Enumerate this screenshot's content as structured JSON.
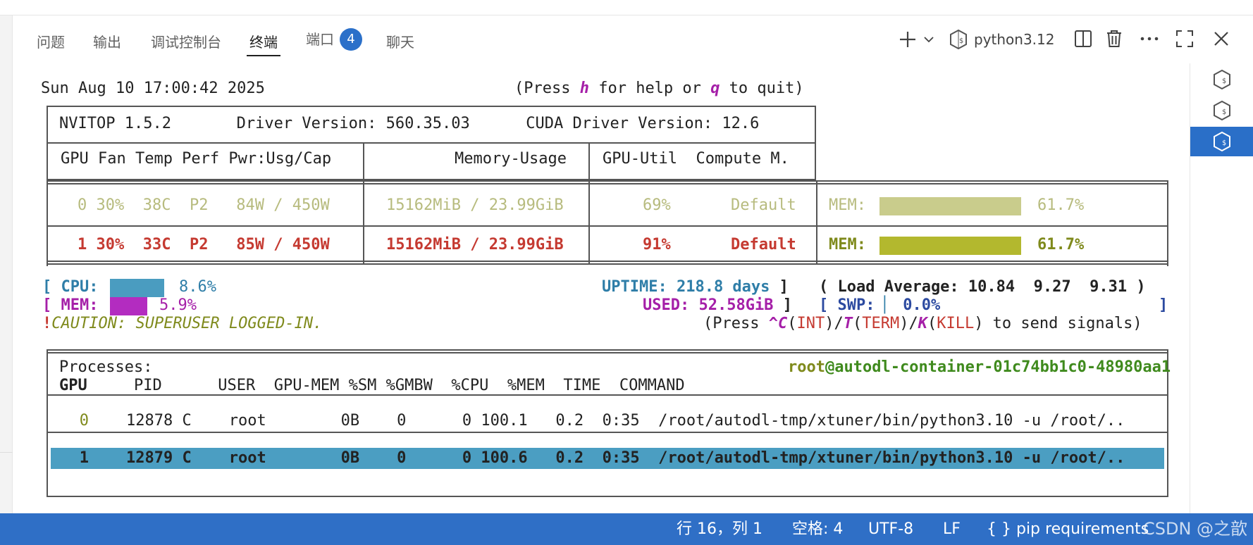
{
  "panel": {
    "tabs": [
      {
        "label": "问题"
      },
      {
        "label": "输出"
      },
      {
        "label": "调试控制台"
      },
      {
        "label": "终端"
      },
      {
        "label": "端口",
        "badge": "4"
      },
      {
        "label": "聊天"
      }
    ],
    "active_tab": "终端",
    "profile_label": "python3.12",
    "icons": [
      "plus-icon",
      "chevron-down-icon",
      "python-shell-icon",
      "split-icon",
      "trash-icon",
      "ellipsis-icon",
      "maximize-icon",
      "close-icon"
    ]
  },
  "terminal": {
    "datetime": "Sun Aug 10 17:00:42 2025",
    "help": {
      "pre": "(Press ",
      "k1": "h",
      "mid": " for help or ",
      "k2": "q",
      "post": " to quit)"
    },
    "header_line1": "NVITOP 1.5.2       Driver Version: 560.35.03      CUDA Driver Version: 12.6",
    "header_line2": {
      "left": "GPU Fan Temp Perf Pwr:Usg/Cap",
      "mid": "Memory-Usage",
      "right": "GPU-Util  Compute M."
    },
    "gpus": [
      {
        "id": "0",
        "fan": "30%",
        "temp": "38C",
        "perf": "P2",
        "pwr": "84W / 450W",
        "mem": "15162MiB / 23.99GiB",
        "util": "69%",
        "compute": "Default",
        "mem_label": "MEM:",
        "mem_pct": "61.7%",
        "mem_frac": 0.617
      },
      {
        "id": "1",
        "fan": "30%",
        "temp": "33C",
        "perf": "P2",
        "pwr": "85W / 450W",
        "mem": "15162MiB / 23.99GiB",
        "util": "91%",
        "compute": "Default",
        "mem_label": "MEM:",
        "mem_pct": "61.7%",
        "mem_frac": 0.617
      }
    ],
    "host": {
      "cpu_label": "CPU:",
      "cpu_pct": "8.6%",
      "cpu_frac": 0.086,
      "mem_label": "MEM:",
      "mem_pct": "5.9%",
      "mem_frac": 0.059,
      "uptime": "UPTIME: 218.8 days",
      "load": "( Load Average: 10.84  9.27  9.31 )",
      "used": "USED: 52.58GiB",
      "swp_label": "SWP:",
      "swp_pct": "0.0%",
      "caution": "CAUTION: SUPERUSER LOGGED-IN.",
      "signals": {
        "pre": "(Press ",
        "c": "^C",
        "int": "INT",
        "t": "T",
        "term": "TERM",
        "k": "K",
        "kill": "KILL",
        "post": " to send signals)"
      }
    },
    "processes": {
      "title": "Processes:",
      "user": "root",
      "host": "autodl-container-01c74bb1c0-48980aa1",
      "columns": [
        "GPU",
        "PID",
        "USER",
        "GPU-MEM",
        "%SM",
        "%GMBW",
        "%CPU",
        "%MEM",
        "TIME",
        "COMMAND"
      ],
      "rows": [
        {
          "gpu": "0",
          "pid": "12878",
          "type": "C",
          "user": "root",
          "gpu_mem": "0B",
          "sm": "0",
          "gmbw": "0",
          "cpu": "100.1",
          "mem": "0.2",
          "time": "0:35",
          "command": "/root/autodl-tmp/xtuner/bin/python3.10 -u /root/..",
          "selected": false
        },
        {
          "gpu": "1",
          "pid": "12879",
          "type": "C",
          "user": "root",
          "gpu_mem": "0B",
          "sm": "0",
          "gmbw": "0",
          "cpu": "100.6",
          "mem": "0.2",
          "time": "0:35",
          "command": "/root/autodl-tmp/xtuner/bin/python3.10 -u /root/..",
          "selected": true
        }
      ]
    }
  },
  "statusbar": {
    "position": "行 16，列 1",
    "spaces": "空格: 4",
    "encoding": "UTF-8",
    "eol": "LF",
    "language": "{ } pip requirements",
    "watermark": "CSDN @之歆"
  },
  "colors": {
    "accent": "#2f6fc6",
    "gpu0": "#b7bb7e",
    "gpu1": "#c53a31",
    "cpu_bar": "#4a9cc0",
    "mem_bar": "#b32cc0",
    "gpu0_bar": "#c9cc8c",
    "gpu1_bar": "#b3b82e",
    "selected_row": "#4b9ec2"
  }
}
